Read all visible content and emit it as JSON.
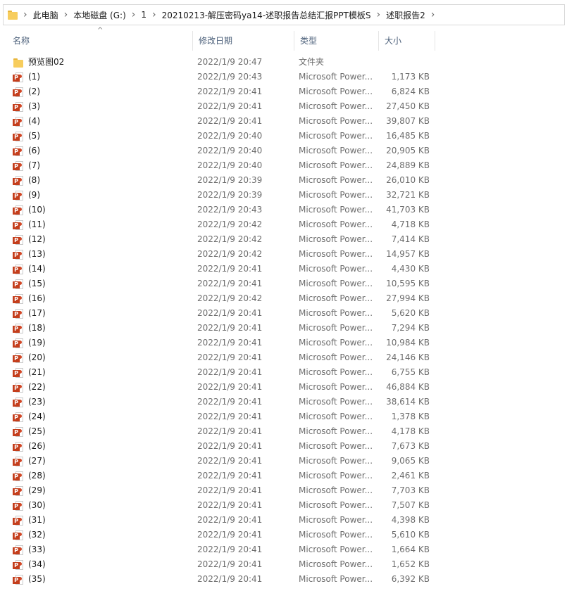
{
  "breadcrumb": [
    "此电脑",
    "本地磁盘 (G:)",
    "1",
    "20210213-解压密码ya14-述职报告总结汇报PPT模板S",
    "述职报告2"
  ],
  "columns": {
    "name": "名称",
    "date": "修改日期",
    "type": "类型",
    "size": "大小"
  },
  "files": [
    {
      "name": "预览图02",
      "date": "2022/1/9 20:47",
      "type": "文件夹",
      "size": "",
      "icon": "folder-icon"
    },
    {
      "name": "(1)",
      "date": "2022/1/9 20:43",
      "type": "Microsoft Power...",
      "size": "1,173 KB",
      "icon": "pptx-icon"
    },
    {
      "name": "(2)",
      "date": "2022/1/9 20:41",
      "type": "Microsoft Power...",
      "size": "6,824 KB",
      "icon": "pptx-icon"
    },
    {
      "name": "(3)",
      "date": "2022/1/9 20:41",
      "type": "Microsoft Power...",
      "size": "27,450 KB",
      "icon": "pptx-icon"
    },
    {
      "name": "(4)",
      "date": "2022/1/9 20:41",
      "type": "Microsoft Power...",
      "size": "39,807 KB",
      "icon": "pptx-icon"
    },
    {
      "name": "(5)",
      "date": "2022/1/9 20:40",
      "type": "Microsoft Power...",
      "size": "16,485 KB",
      "icon": "pptx-icon"
    },
    {
      "name": "(6)",
      "date": "2022/1/9 20:40",
      "type": "Microsoft Power...",
      "size": "20,905 KB",
      "icon": "pptx-icon"
    },
    {
      "name": "(7)",
      "date": "2022/1/9 20:40",
      "type": "Microsoft Power...",
      "size": "24,889 KB",
      "icon": "pptx-icon"
    },
    {
      "name": "(8)",
      "date": "2022/1/9 20:39",
      "type": "Microsoft Power...",
      "size": "26,010 KB",
      "icon": "pptx-icon"
    },
    {
      "name": "(9)",
      "date": "2022/1/9 20:39",
      "type": "Microsoft Power...",
      "size": "32,721 KB",
      "icon": "pptx-icon"
    },
    {
      "name": "(10)",
      "date": "2022/1/9 20:43",
      "type": "Microsoft Power...",
      "size": "41,703 KB",
      "icon": "pptx-icon"
    },
    {
      "name": "(11)",
      "date": "2022/1/9 20:42",
      "type": "Microsoft Power...",
      "size": "4,718 KB",
      "icon": "pptx-icon"
    },
    {
      "name": "(12)",
      "date": "2022/1/9 20:42",
      "type": "Microsoft Power...",
      "size": "7,414 KB",
      "icon": "pptx-icon"
    },
    {
      "name": "(13)",
      "date": "2022/1/9 20:42",
      "type": "Microsoft Power...",
      "size": "14,957 KB",
      "icon": "pptx-icon"
    },
    {
      "name": "(14)",
      "date": "2022/1/9 20:41",
      "type": "Microsoft Power...",
      "size": "4,430 KB",
      "icon": "pptx-icon"
    },
    {
      "name": "(15)",
      "date": "2022/1/9 20:41",
      "type": "Microsoft Power...",
      "size": "10,595 KB",
      "icon": "pptx-icon"
    },
    {
      "name": "(16)",
      "date": "2022/1/9 20:42",
      "type": "Microsoft Power...",
      "size": "27,994 KB",
      "icon": "pptx-icon"
    },
    {
      "name": "(17)",
      "date": "2022/1/9 20:41",
      "type": "Microsoft Power...",
      "size": "5,620 KB",
      "icon": "pptx-icon"
    },
    {
      "name": "(18)",
      "date": "2022/1/9 20:41",
      "type": "Microsoft Power...",
      "size": "7,294 KB",
      "icon": "pptx-icon"
    },
    {
      "name": "(19)",
      "date": "2022/1/9 20:41",
      "type": "Microsoft Power...",
      "size": "10,984 KB",
      "icon": "pptx-icon"
    },
    {
      "name": "(20)",
      "date": "2022/1/9 20:41",
      "type": "Microsoft Power...",
      "size": "24,146 KB",
      "icon": "pptx-icon"
    },
    {
      "name": "(21)",
      "date": "2022/1/9 20:41",
      "type": "Microsoft Power...",
      "size": "6,755 KB",
      "icon": "pptx-icon"
    },
    {
      "name": "(22)",
      "date": "2022/1/9 20:41",
      "type": "Microsoft Power...",
      "size": "46,884 KB",
      "icon": "pptx-icon"
    },
    {
      "name": "(23)",
      "date": "2022/1/9 20:41",
      "type": "Microsoft Power...",
      "size": "38,614 KB",
      "icon": "pptx-icon"
    },
    {
      "name": "(24)",
      "date": "2022/1/9 20:41",
      "type": "Microsoft Power...",
      "size": "1,378 KB",
      "icon": "pptx-icon"
    },
    {
      "name": "(25)",
      "date": "2022/1/9 20:41",
      "type": "Microsoft Power...",
      "size": "4,178 KB",
      "icon": "pptx-icon"
    },
    {
      "name": "(26)",
      "date": "2022/1/9 20:41",
      "type": "Microsoft Power...",
      "size": "7,673 KB",
      "icon": "pptx-icon"
    },
    {
      "name": "(27)",
      "date": "2022/1/9 20:41",
      "type": "Microsoft Power...",
      "size": "9,065 KB",
      "icon": "pptx-icon"
    },
    {
      "name": "(28)",
      "date": "2022/1/9 20:41",
      "type": "Microsoft Power...",
      "size": "2,461 KB",
      "icon": "pptx-icon"
    },
    {
      "name": "(29)",
      "date": "2022/1/9 20:41",
      "type": "Microsoft Power...",
      "size": "7,703 KB",
      "icon": "pptx-icon"
    },
    {
      "name": "(30)",
      "date": "2022/1/9 20:41",
      "type": "Microsoft Power...",
      "size": "7,507 KB",
      "icon": "pptx-icon"
    },
    {
      "name": "(31)",
      "date": "2022/1/9 20:41",
      "type": "Microsoft Power...",
      "size": "4,398 KB",
      "icon": "pptx-icon"
    },
    {
      "name": "(32)",
      "date": "2022/1/9 20:41",
      "type": "Microsoft Power...",
      "size": "5,610 KB",
      "icon": "pptx-icon"
    },
    {
      "name": "(33)",
      "date": "2022/1/9 20:41",
      "type": "Microsoft Power...",
      "size": "1,664 KB",
      "icon": "pptx-icon"
    },
    {
      "name": "(34)",
      "date": "2022/1/9 20:41",
      "type": "Microsoft Power...",
      "size": "1,652 KB",
      "icon": "pptx-icon"
    },
    {
      "name": "(35)",
      "date": "2022/1/9 20:41",
      "type": "Microsoft Power...",
      "size": "6,392 KB",
      "icon": "pptx-icon"
    }
  ]
}
